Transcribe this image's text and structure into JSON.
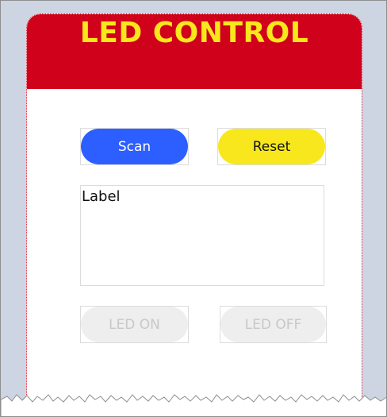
{
  "app": {
    "title": "LED CONTROL"
  },
  "buttons": {
    "scan_label": "Scan",
    "reset_label": "Reset",
    "led_on_label": "LED ON",
    "led_off_label": "LED OFF"
  },
  "label_box": {
    "text": "Label"
  },
  "colors": {
    "header": "#d0021b",
    "title": "#f8e71c",
    "scan": "#2d5eff",
    "reset": "#f8e71c",
    "disabled": "#eeeeee",
    "background": "#cdd5e3"
  }
}
